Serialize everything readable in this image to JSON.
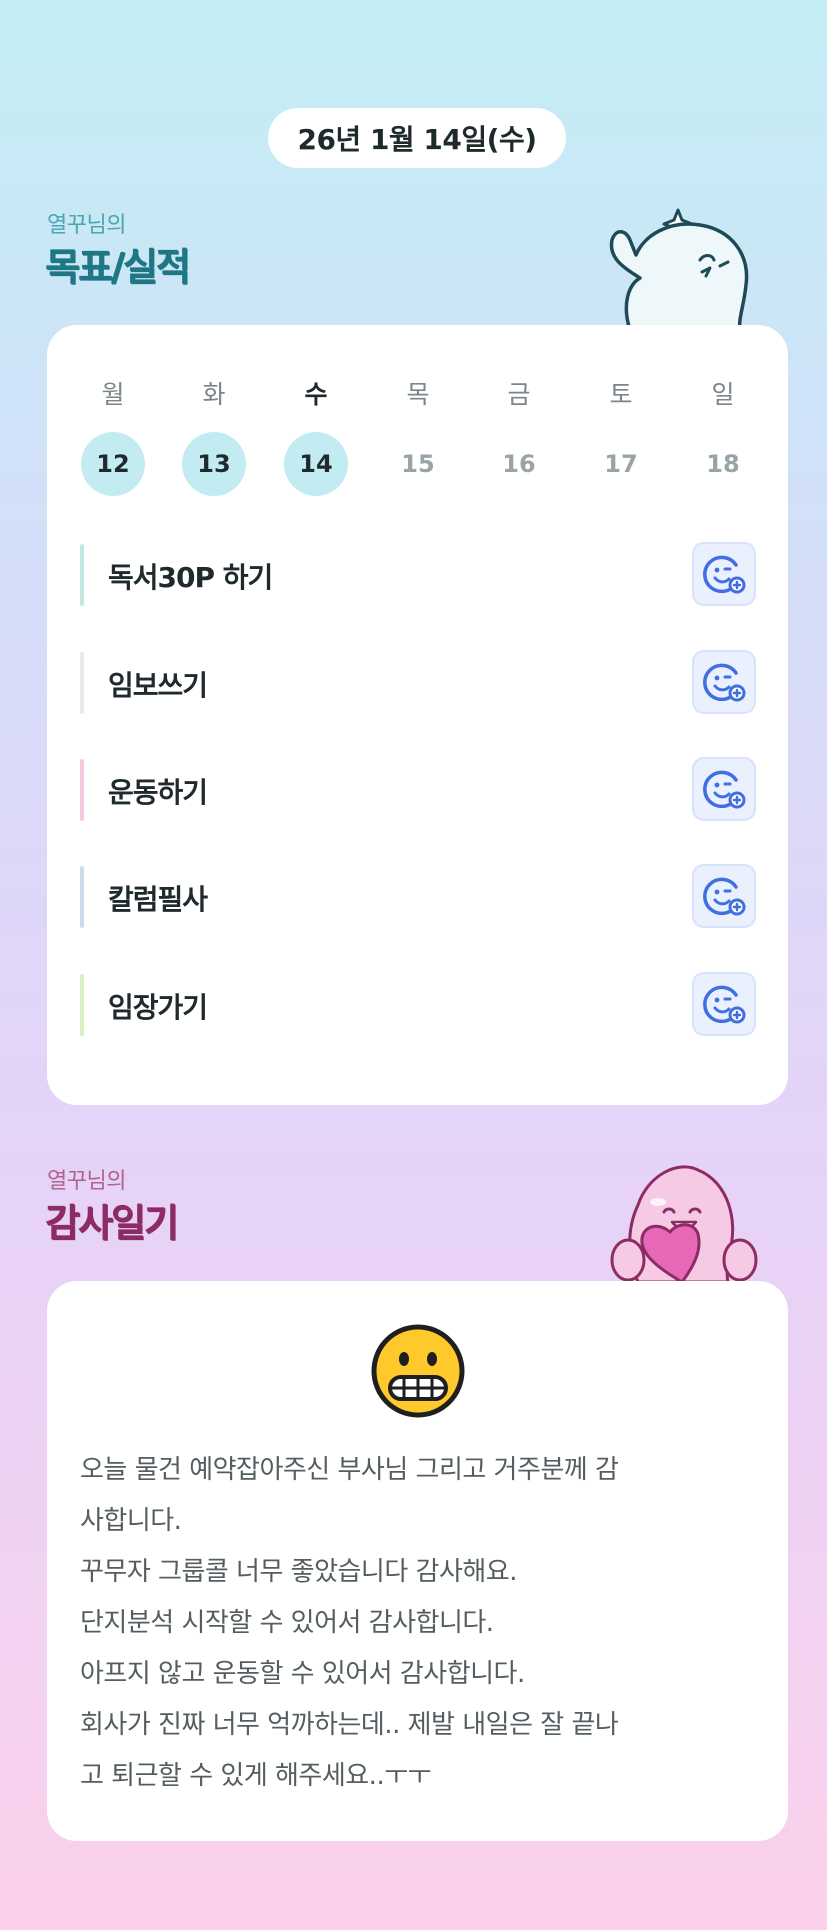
{
  "header": {
    "date": "26년 1월 14일(수)"
  },
  "goals_section": {
    "subtitle": "열꾸님의",
    "title": "목표/실적"
  },
  "week": {
    "weekdays": [
      "월",
      "화",
      "수",
      "목",
      "금",
      "토",
      "일"
    ],
    "days": [
      "12",
      "13",
      "14",
      "15",
      "16",
      "17",
      "18"
    ],
    "today_index": 2,
    "filled_days": [
      0,
      1,
      2
    ]
  },
  "goals": [
    {
      "label": "독서30P 하기",
      "color": "#bfe8e3",
      "react_icon": "smile-add-icon"
    },
    {
      "label": "임보쓰기",
      "color": "#e7eaec",
      "react_icon": "smile-add-icon"
    },
    {
      "label": "운동하기",
      "color": "#f6c8df",
      "react_icon": "smile-add-icon"
    },
    {
      "label": "칼럼필사",
      "color": "#cadbee",
      "react_icon": "smile-add-icon"
    },
    {
      "label": "임장가기",
      "color": "#d8efc2",
      "react_icon": "smile-add-icon"
    }
  ],
  "diary_section": {
    "subtitle": "열꾸님의",
    "title": "감사일기",
    "emoji": "grimacing-face-icon",
    "lines": [
      "오늘 물건 예약잡아주신 부사님 그리고 거주분께 감",
      "사합니다.",
      "꾸무자 그룹콜 너무 좋았습니다 감사해요.",
      "단지분석 시작할 수 있어서 감사합니다.",
      "아프지 않고 운동할 수 있어서 감사합니다.",
      "회사가 진짜 너무 억까하는데.. 제발 내일은 잘 끝나",
      "고 퇴근할 수 있게 해주세요..ㅜㅜ"
    ]
  },
  "colors": {
    "accent_teal": "#1e7782",
    "accent_pink": "#8d2c63",
    "day_fill": "#c3ecf2",
    "react_icon": "#3f6fe0"
  }
}
